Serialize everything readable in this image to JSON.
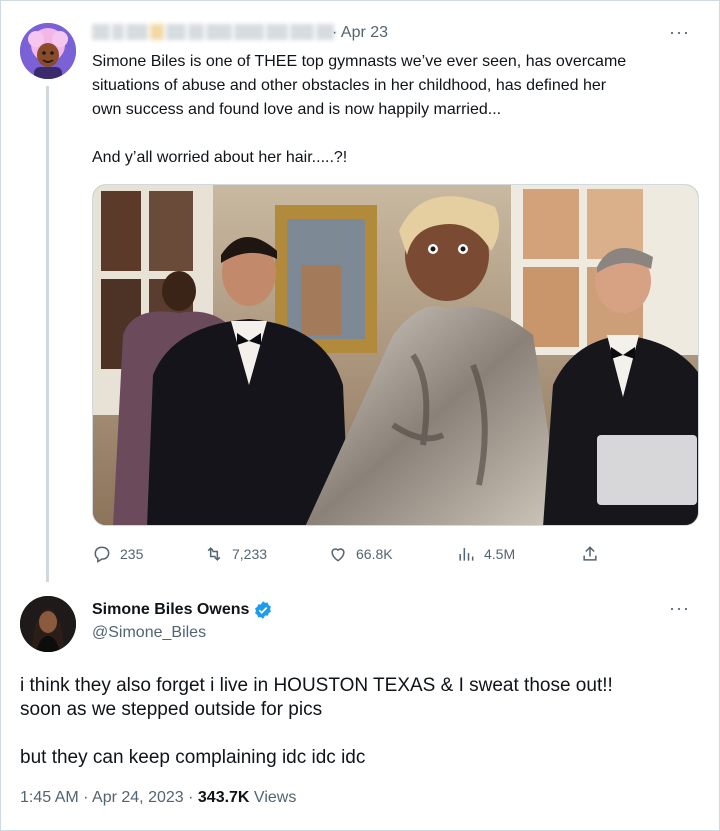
{
  "tweet1": {
    "date": "Apr 23",
    "more_icon": "more-dots-icon",
    "line1": "Simone Biles is one of THEE top gymnasts we’ve ever seen, has overcame",
    "line2": "situations of abuse and other obstacles in her childhood, has defined her",
    "line3": "own success and found love and is now happily married...",
    "line4": "And y’all worried about her hair.....?!",
    "actions": {
      "replies": "235",
      "retweets": "7,233",
      "likes": "66.8K",
      "views": "4.5M"
    }
  },
  "tweet2": {
    "name": "Simone Biles Owens",
    "handle": "@Simone_Biles",
    "line1": "i think they also forget i live in HOUSTON TEXAS & I sweat those out!!",
    "line2": "soon as we stepped outside for pics",
    "line3": "but they can keep complaining idc idc idc",
    "time": "1:45 AM · Apr 24, 2023 · ",
    "views_count": "343.7K",
    "views_label": " Views"
  },
  "colors": {
    "text": "#0f1419",
    "muted": "#536471",
    "border": "#cfd9de",
    "verified": "#1d9bf0"
  }
}
